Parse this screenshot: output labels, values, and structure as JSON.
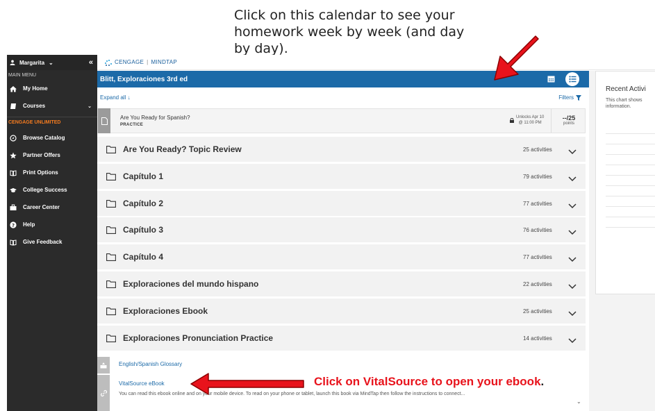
{
  "annotations": {
    "top_line1": "Click on this calendar to see your",
    "top_line2": "homework week by week (and day",
    "top_line3": "by day).",
    "bottom": "Click on VitalSource to open your ebook",
    "bottom_end": "."
  },
  "sidebar": {
    "user_name": "Margarita",
    "main_menu_label": "MAIN MENU",
    "unlimited_label": "CENGAGE UNLIMITED",
    "items": [
      {
        "label": "My Home",
        "icon": "home-icon"
      },
      {
        "label": "Courses",
        "icon": "book-icon"
      },
      {
        "label": "Browse Catalog",
        "icon": "compass-icon"
      },
      {
        "label": "Partner Offers",
        "icon": "star-icon"
      },
      {
        "label": "Print Options",
        "icon": "open-book-icon"
      },
      {
        "label": "College Success",
        "icon": "graduation-cap-icon"
      },
      {
        "label": "Career Center",
        "icon": "briefcase-icon"
      },
      {
        "label": "Help",
        "icon": "question-icon"
      },
      {
        "label": "Give Feedback",
        "icon": "feedback-icon"
      }
    ]
  },
  "topbar": {
    "brand_left": "CENGAGE",
    "brand_right": "MINDTAP"
  },
  "course": {
    "title": "Blitt, Exploraciones 3rd ed",
    "expand_all": "Expand all",
    "filters": "Filters"
  },
  "practice": {
    "title": "Are You Ready for Spanish?",
    "type": "PRACTICE",
    "unlock_line1": "Unlocks Apr 10",
    "unlock_line2": "@ 11:00 PM",
    "points_value": "--/25",
    "points_label": "points"
  },
  "folders": [
    {
      "title": "Are You Ready? Topic Review",
      "count": "25 activities"
    },
    {
      "title": "Capítulo 1",
      "count": "79 activities"
    },
    {
      "title": "Capítulo 2",
      "count": "77 activities"
    },
    {
      "title": "Capítulo 3",
      "count": "76 activities"
    },
    {
      "title": "Capítulo 4",
      "count": "77 activities"
    },
    {
      "title": "Exploraciones del mundo hispano",
      "count": "22 activities"
    },
    {
      "title": "Exploraciones Ebook",
      "count": "25 activities"
    },
    {
      "title": "Exploraciones Pronunciation Practice",
      "count": "14 activities"
    }
  ],
  "glossary": {
    "title": "English/Spanish Glossary"
  },
  "vitalsource": {
    "title": "VitalSource eBook",
    "description": "You can read this ebook online and on your mobile device. To read on your phone or tablet, launch this book via MindTap then follow the instructions to connect..."
  },
  "right_panel": {
    "title": "Recent Activi",
    "desc_line1": "This chart shows",
    "desc_line2": "information."
  },
  "colors": {
    "header_blue": "#1c6aa8",
    "sidebar_dark": "#2b2b2b",
    "accent_orange": "#f47b20",
    "annotation_red": "#e8131c"
  }
}
